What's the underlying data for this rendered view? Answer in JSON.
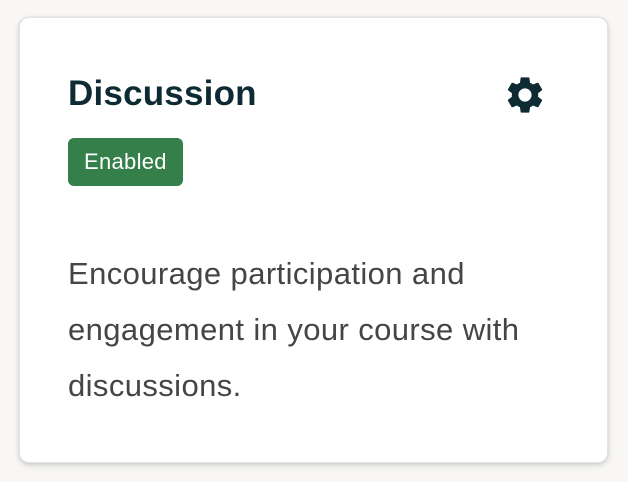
{
  "card": {
    "title": "Discussion",
    "status": "Enabled",
    "description": "Encourage participation and engagement in your course with discussions.",
    "settings_icon": "gear-icon"
  },
  "colors": {
    "background": "#f8f7f5",
    "card_background": "#ffffff",
    "title": "#0e2a33",
    "icon": "#0e2a33",
    "badge_background": "#347f4a",
    "badge_text": "#ffffff",
    "description": "#454545"
  }
}
